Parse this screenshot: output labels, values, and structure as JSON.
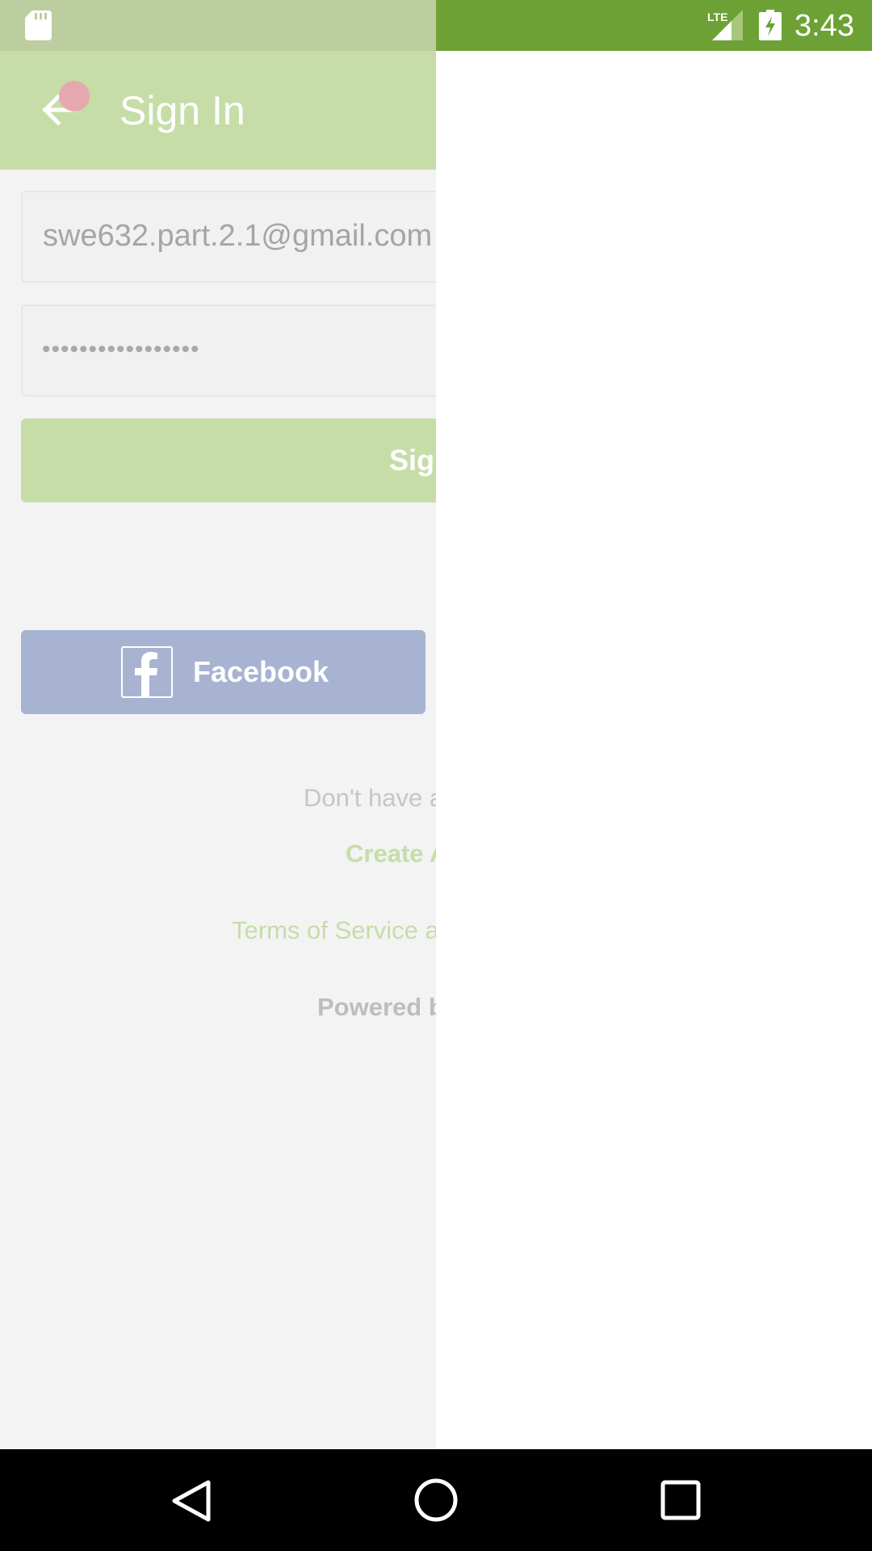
{
  "status_bar": {
    "time": "3:43",
    "left_icon": "sd-card-icon",
    "network_label": "LTE",
    "icons": [
      "lte-signal-icon",
      "battery-charging-icon"
    ]
  },
  "toolbar": {
    "back_icon": "arrow-back-icon",
    "title": "Sign In"
  },
  "form": {
    "email_value": "swe632.part.2.1@gmail.com",
    "password_mask": "•••••••••••••••••",
    "sign_in_label": "Sig"
  },
  "social": {
    "facebook_label": "Facebook",
    "facebook_icon": "facebook-icon"
  },
  "footer": {
    "no_account_text": "Don't have a",
    "create_account_link": "Create A",
    "terms_link": "Terms of Service a",
    "powered_by": "Powered b"
  },
  "colors": {
    "status_bar": "#6ea135",
    "toolbar_dimmed": "#c6dda8",
    "background_dimmed": "#f3f3f3",
    "facebook_dimmed": "#a7b3d1",
    "panel": "#ffffff"
  },
  "nav_bar": {
    "buttons": [
      "back-icon",
      "home-icon",
      "recents-icon"
    ]
  }
}
